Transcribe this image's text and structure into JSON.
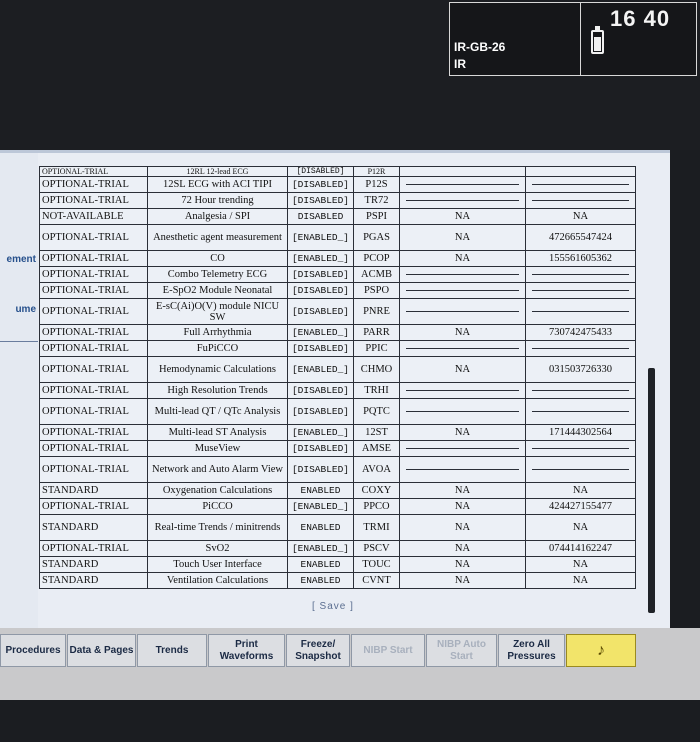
{
  "header": {
    "bed_label": "IR-GB-26",
    "unit_label": "IR",
    "clock": "16 40",
    "battery_level": 0.75
  },
  "left_panel": {
    "label_1": "ement",
    "label_2": "ume"
  },
  "features": {
    "partial_row": {
      "package": "OPTIONAL-TRIAL",
      "description": "12RL 12-lead ECG",
      "status": "[DISABLED]",
      "code": "P12R"
    },
    "rows": [
      {
        "package": "OPTIONAL-TRIAL",
        "description": "12SL ECG with ACI TIPI",
        "status": "[DISABLED]",
        "code": "P12S",
        "col5": "",
        "col6": ""
      },
      {
        "package": "OPTIONAL-TRIAL",
        "description": "72 Hour trending",
        "status": "[DISABLED]",
        "code": "TR72",
        "col5": "",
        "col6": ""
      },
      {
        "package": "NOT-AVAILABLE",
        "description": "Analgesia / SPI",
        "status": "DISABLED",
        "code": "PSPI",
        "col5": "NA",
        "col6": "NA"
      },
      {
        "package": "OPTIONAL-TRIAL",
        "description": "Anesthetic agent measurement",
        "status": "[ENABLED_]",
        "code": "PGAS",
        "col5": "NA",
        "col6": "472665547424"
      },
      {
        "package": "OPTIONAL-TRIAL",
        "description": "CO",
        "status": "[ENABLED_]",
        "code": "PCOP",
        "col5": "NA",
        "col6": "155561605362"
      },
      {
        "package": "OPTIONAL-TRIAL",
        "description": "Combo Telemetry ECG",
        "status": "[DISABLED]",
        "code": "ACMB",
        "col5": "",
        "col6": ""
      },
      {
        "package": "OPTIONAL-TRIAL",
        "description": "E-SpO2 Module Neonatal",
        "status": "[DISABLED]",
        "code": "PSPO",
        "col5": "",
        "col6": ""
      },
      {
        "package": "OPTIONAL-TRIAL",
        "description": "E-sC(Ai)O(V) module NICU SW",
        "status": "[DISABLED]",
        "code": "PNRE",
        "col5": "",
        "col6": ""
      },
      {
        "package": "OPTIONAL-TRIAL",
        "description": "Full Arrhythmia",
        "status": "[ENABLED_]",
        "code": "PARR",
        "col5": "NA",
        "col6": "730742475433"
      },
      {
        "package": "OPTIONAL-TRIAL",
        "description": "FuPiCCO",
        "status": "[DISABLED]",
        "code": "PPIC",
        "col5": "",
        "col6": ""
      },
      {
        "package": "OPTIONAL-TRIAL",
        "description": "Hemodynamic Calculations",
        "status": "[ENABLED_]",
        "code": "CHMO",
        "col5": "NA",
        "col6": "031503726330"
      },
      {
        "package": "OPTIONAL-TRIAL",
        "description": "High Resolution Trends",
        "status": "[DISABLED]",
        "code": "TRHI",
        "col5": "",
        "col6": ""
      },
      {
        "package": "OPTIONAL-TRIAL",
        "description": "Multi-lead QT / QTc Analysis",
        "status": "[DISABLED]",
        "code": "PQTC",
        "col5": "",
        "col6": ""
      },
      {
        "package": "OPTIONAL-TRIAL",
        "description": "Multi-lead ST Analysis",
        "status": "[ENABLED_]",
        "code": "12ST",
        "col5": "NA",
        "col6": "171444302564"
      },
      {
        "package": "OPTIONAL-TRIAL",
        "description": "MuseView",
        "status": "[DISABLED]",
        "code": "AMSE",
        "col5": "",
        "col6": ""
      },
      {
        "package": "OPTIONAL-TRIAL",
        "description": "Network and Auto Alarm View",
        "status": "[DISABLED]",
        "code": "AVOA",
        "col5": "",
        "col6": ""
      },
      {
        "package": "STANDARD",
        "description": "Oxygenation Calculations",
        "status": "ENABLED",
        "code": "COXY",
        "col5": "NA",
        "col6": "NA"
      },
      {
        "package": "OPTIONAL-TRIAL",
        "description": "PiCCO",
        "status": "[ENABLED_]",
        "code": "PPCO",
        "col5": "NA",
        "col6": "424427155477"
      },
      {
        "package": "STANDARD",
        "description": "Real-time Trends / minitrends",
        "status": "ENABLED",
        "code": "TRMI",
        "col5": "NA",
        "col6": "NA"
      },
      {
        "package": "OPTIONAL-TRIAL",
        "description": "SvO2",
        "status": "[ENABLED_]",
        "code": "PSCV",
        "col5": "NA",
        "col6": "074414162247"
      },
      {
        "package": "STANDARD",
        "description": "Touch User Interface",
        "status": "ENABLED",
        "code": "TOUC",
        "col5": "NA",
        "col6": "NA"
      },
      {
        "package": "STANDARD",
        "description": "Ventilation Calculations",
        "status": "ENABLED",
        "code": "CVNT",
        "col5": "NA",
        "col6": "NA"
      }
    ]
  },
  "save_label": "[ Save ]",
  "buttons": {
    "procedures": "Procedures",
    "data_pages": "Data & Pages",
    "trends": "Trends",
    "print_waveforms": "Print Waveforms",
    "freeze_snapshot": "Freeze/ Snapshot",
    "nibp_start": "NIBP Start",
    "nibp_auto_start": "NIBP Auto Start",
    "zero_all_pressures": "Zero All Pressures",
    "alarm_icon": "bell-icon"
  }
}
